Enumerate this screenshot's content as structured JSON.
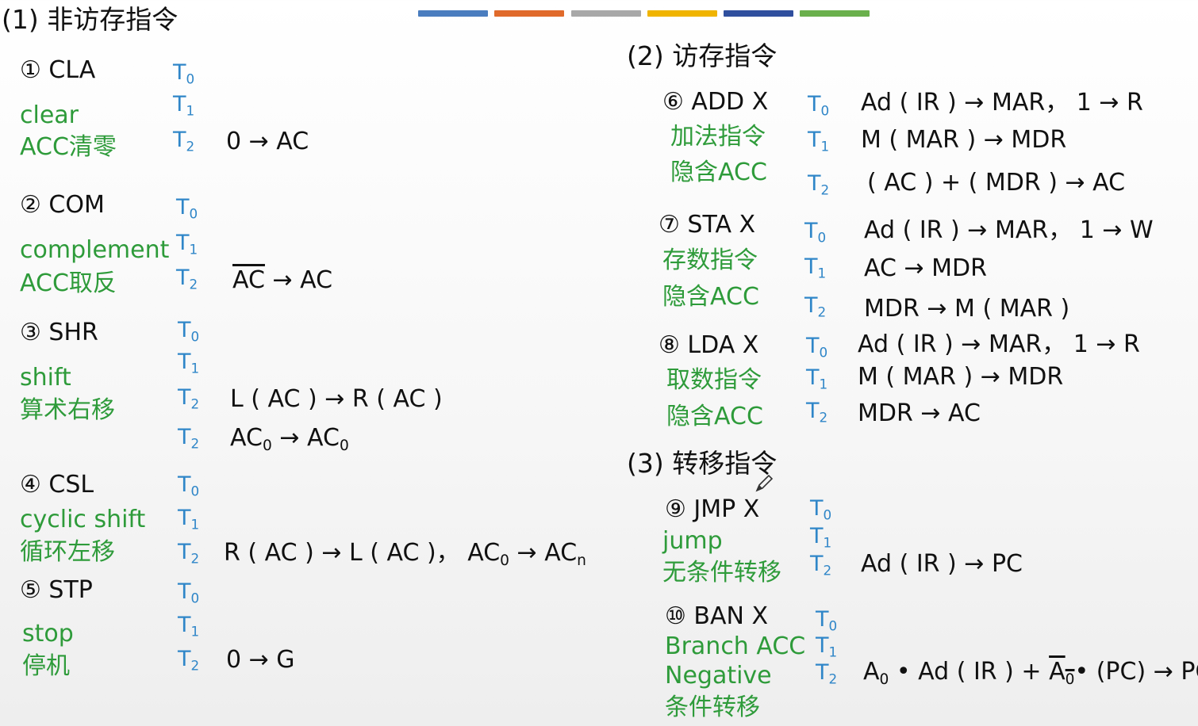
{
  "palette": {
    "colors": [
      "#4a7dbf",
      "#e06a2b",
      "#a8a8a8",
      "#f0b400",
      "#2f4f9e",
      "#6ab04c"
    ]
  },
  "sections": {
    "s1": "(1) 非访存指令",
    "s2": "(2) 访存指令",
    "s3": "(3) 转移指令"
  },
  "instr": {
    "cla": {
      "name": "① CLA",
      "en": "clear",
      "cn": "ACC清零",
      "op": "0 → AC"
    },
    "com": {
      "name": "② COM",
      "en": "complement",
      "cn": "ACC取反",
      "op_bar": "AC",
      "op_rest": " → AC"
    },
    "shr": {
      "name": "③ SHR",
      "en": "shift",
      "cn": "算术右移",
      "op1": "L ( AC ) → R ( AC )",
      "op2_a": "AC",
      "op2_sub": "0",
      "op2_b": " → AC",
      "op2_sub2": "0"
    },
    "csl": {
      "name": "④ CSL",
      "en": "cyclic shift",
      "cn": "循环左移",
      "op_a": "R ( AC ) → L ( AC )，  AC",
      "op_sub": "0",
      "op_b": " → AC",
      "op_sub2": "n"
    },
    "stp": {
      "name": "⑤ STP",
      "en": "stop",
      "cn": "停机",
      "op": "0 → G"
    },
    "add": {
      "name": "⑥ ADD  X",
      "cn1": "加法指令",
      "cn2": "隐含ACC",
      "op0": "Ad ( IR ) → MAR， 1 → R",
      "op1": "M ( MAR ) → MDR",
      "op2": "( AC ) + ( MDR ) → AC"
    },
    "sta": {
      "name": "⑦ STA  X",
      "cn1": "存数指令",
      "cn2": "隐含ACC",
      "op0": "Ad ( IR ) → MAR， 1 → W",
      "op1": "AC → MDR",
      "op2": "MDR → M ( MAR )"
    },
    "lda": {
      "name": "⑧ LDA  X",
      "cn1": "取数指令",
      "cn2": "隐含ACC",
      "op0": "Ad ( IR ) → MAR，  1 → R",
      "op1": "M ( MAR ) → MDR",
      "op2": "MDR → AC"
    },
    "jmp": {
      "name": "⑨ JMP  X",
      "en": "jump",
      "cn": "无条件转移",
      "op": "Ad ( IR ) → PC"
    },
    "ban": {
      "name": "⑩ BAN  X",
      "en1": "Branch ACC",
      "en2": "Negative",
      "cn": "条件转移",
      "op_a": "A",
      "op_a_sub": "0",
      "op_mid": " • Ad ( IR ) + ",
      "op_bar": "A",
      "op_bar_sub": "0",
      "op_end": "• (PC) → PC"
    }
  },
  "t": {
    "T": "T",
    "s0": "0",
    "s1": "1",
    "s2": "2"
  }
}
